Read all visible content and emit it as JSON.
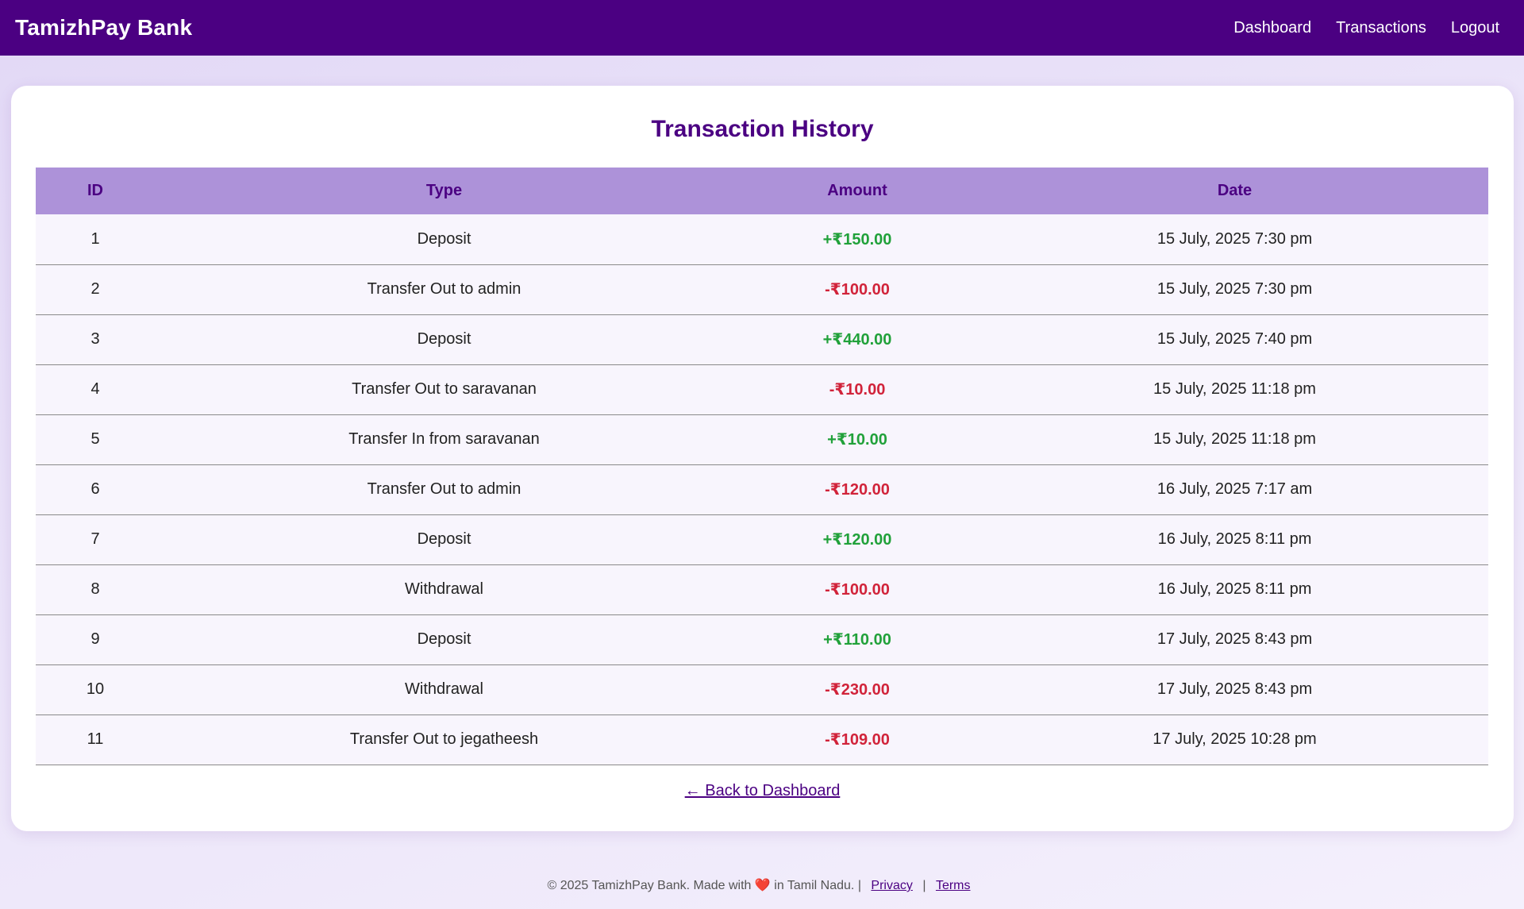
{
  "header": {
    "brand": "TamizhPay Bank",
    "nav": [
      "Dashboard",
      "Transactions",
      "Logout"
    ]
  },
  "page": {
    "title": "Transaction History",
    "back_link": "← Back to Dashboard"
  },
  "table": {
    "columns": [
      "ID",
      "Type",
      "Amount",
      "Date"
    ],
    "rows": [
      {
        "id": "1",
        "type": "Deposit",
        "amount": "+₹150.00",
        "sign": "pos",
        "date": "15 July, 2025 7:30 pm"
      },
      {
        "id": "2",
        "type": "Transfer Out to admin",
        "amount": "-₹100.00",
        "sign": "neg",
        "date": "15 July, 2025 7:30 pm"
      },
      {
        "id": "3",
        "type": "Deposit",
        "amount": "+₹440.00",
        "sign": "pos",
        "date": "15 July, 2025 7:40 pm"
      },
      {
        "id": "4",
        "type": "Transfer Out to saravanan",
        "amount": "-₹10.00",
        "sign": "neg",
        "date": "15 July, 2025 11:18 pm"
      },
      {
        "id": "5",
        "type": "Transfer In from saravanan",
        "amount": "+₹10.00",
        "sign": "pos",
        "date": "15 July, 2025 11:18 pm"
      },
      {
        "id": "6",
        "type": "Transfer Out to admin",
        "amount": "-₹120.00",
        "sign": "neg",
        "date": "16 July, 2025 7:17 am"
      },
      {
        "id": "7",
        "type": "Deposit",
        "amount": "+₹120.00",
        "sign": "pos",
        "date": "16 July, 2025 8:11 pm"
      },
      {
        "id": "8",
        "type": "Withdrawal",
        "amount": "-₹100.00",
        "sign": "neg",
        "date": "16 July, 2025 8:11 pm"
      },
      {
        "id": "9",
        "type": "Deposit",
        "amount": "+₹110.00",
        "sign": "pos",
        "date": "17 July, 2025 8:43 pm"
      },
      {
        "id": "10",
        "type": "Withdrawal",
        "amount": "-₹230.00",
        "sign": "neg",
        "date": "17 July, 2025 8:43 pm"
      },
      {
        "id": "11",
        "type": "Transfer Out to jegatheesh",
        "amount": "-₹109.00",
        "sign": "neg",
        "date": "17 July, 2025 10:28 pm"
      }
    ]
  },
  "footer": {
    "text_before": "© 2025 TamizhPay Bank. Made with",
    "heart_icon": "heart-icon",
    "text_after": "in Tamil Nadu. |",
    "privacy": "Privacy",
    "separator": "|",
    "terms": "Terms"
  },
  "colors": {
    "brand": "#4b0082",
    "header_row": "#ad92d9",
    "positive": "#21a13a",
    "negative": "#d1233a"
  }
}
